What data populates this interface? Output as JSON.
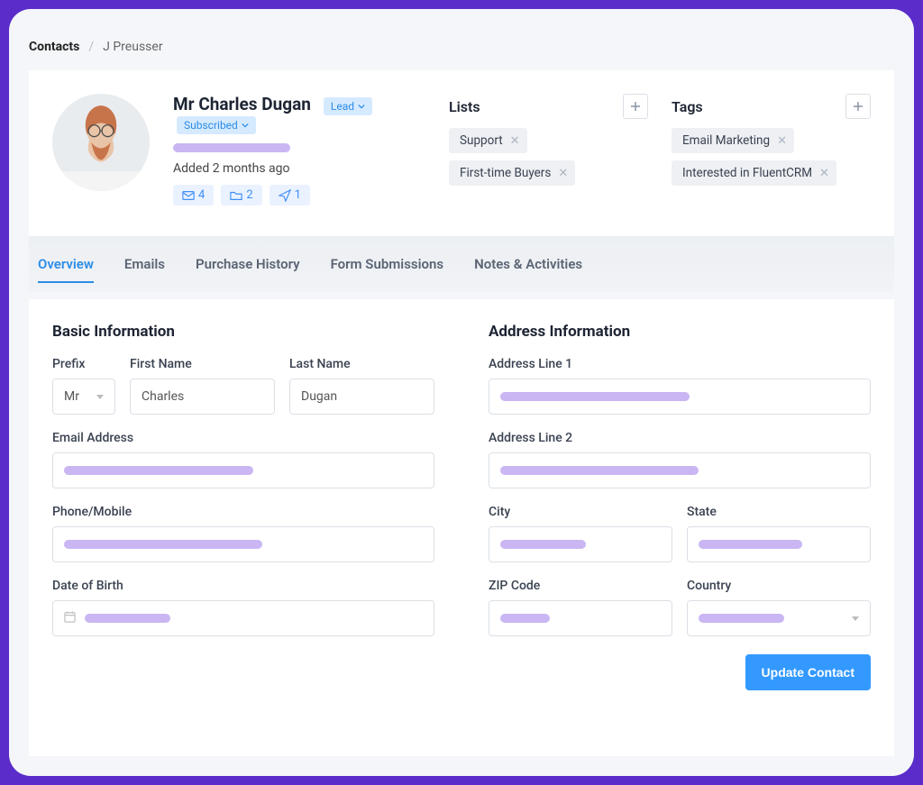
{
  "breadcrumb": {
    "root": "Contacts",
    "current": "J Preusser"
  },
  "profile": {
    "name": "Mr Charles Dugan",
    "type_label": "Lead",
    "status_label": "Subscribed",
    "added_text": "Added 2 months ago",
    "stats": {
      "emails": "4",
      "folders": "2",
      "sends": "1"
    }
  },
  "lists": {
    "heading": "Lists",
    "items": [
      "Support",
      "First-time Buyers"
    ]
  },
  "tags": {
    "heading": "Tags",
    "items": [
      "Email Marketing",
      "Interested in FluentCRM"
    ]
  },
  "tabs": [
    "Overview",
    "Emails",
    "Purchase History",
    "Form Submissions",
    "Notes & Activities"
  ],
  "active_tab": "Overview",
  "basic": {
    "heading": "Basic Information",
    "prefix_label": "Prefix",
    "prefix_value": "Mr",
    "first_name_label": "First Name",
    "first_name_value": "Charles",
    "last_name_label": "Last Name",
    "last_name_value": "Dugan",
    "email_label": "Email Address",
    "phone_label": "Phone/Mobile",
    "dob_label": "Date of Birth"
  },
  "address": {
    "heading": "Address Information",
    "line1_label": "Address Line 1",
    "line2_label": "Address Line 2",
    "city_label": "City",
    "state_label": "State",
    "zip_label": "ZIP Code",
    "country_label": "Country"
  },
  "actions": {
    "update_label": "Update Contact"
  }
}
